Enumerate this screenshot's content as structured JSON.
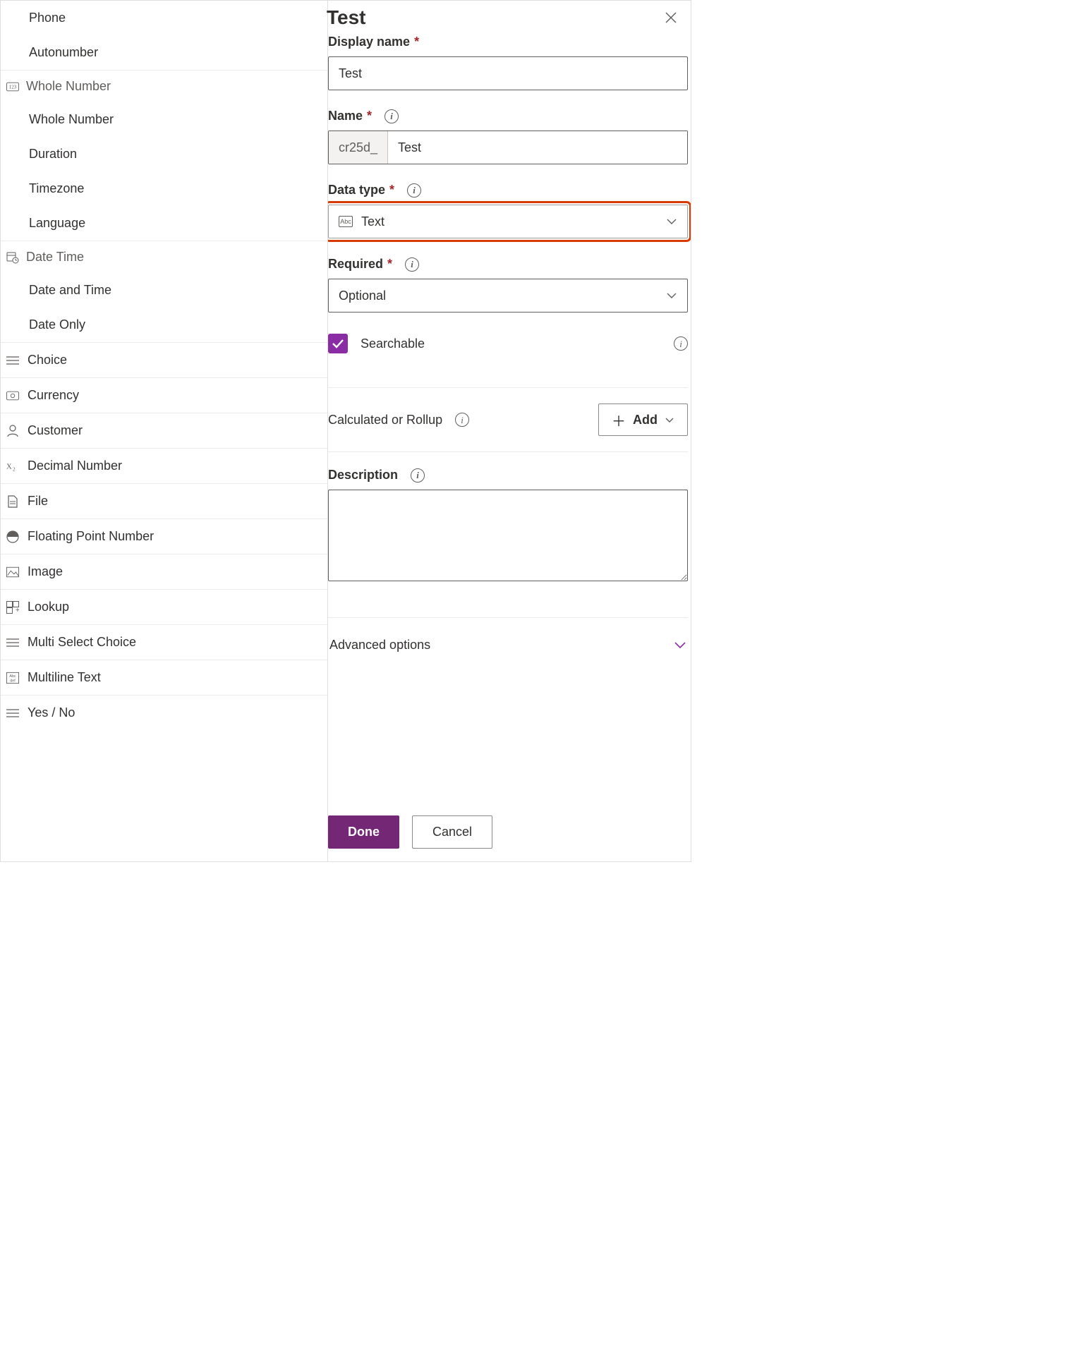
{
  "panel": {
    "title": "Test",
    "close_aria": "Close"
  },
  "fields": {
    "display_name": {
      "label": "Display name",
      "value": "Test"
    },
    "name": {
      "label": "Name",
      "prefix": "cr25d_",
      "value": "Test"
    },
    "data_type": {
      "label": "Data type",
      "value": "Text",
      "icon_text": "Abc"
    },
    "required": {
      "label": "Required",
      "value": "Optional"
    },
    "searchable": {
      "label": "Searchable",
      "checked": true
    },
    "calc_rollup": {
      "label": "Calculated or Rollup",
      "add_label": "Add"
    },
    "description": {
      "label": "Description",
      "value": ""
    },
    "advanced": {
      "label": "Advanced options"
    }
  },
  "footer": {
    "done": "Done",
    "cancel": "Cancel"
  },
  "datatype_picker": {
    "top_orphan_items": [
      "Phone",
      "Autonumber"
    ],
    "groups": [
      {
        "name": "Whole Number",
        "icon": "123",
        "items": [
          "Whole Number",
          "Duration",
          "Timezone",
          "Language"
        ]
      },
      {
        "name": "Date Time",
        "icon": "datetime",
        "items": [
          "Date and Time",
          "Date Only"
        ]
      }
    ],
    "flat_items": [
      {
        "label": "Choice",
        "icon": "list"
      },
      {
        "label": "Currency",
        "icon": "currency"
      },
      {
        "label": "Customer",
        "icon": "person"
      },
      {
        "label": "Decimal Number",
        "icon": "decimal"
      },
      {
        "label": "File",
        "icon": "file"
      },
      {
        "label": "Floating Point Number",
        "icon": "float"
      },
      {
        "label": "Image",
        "icon": "image"
      },
      {
        "label": "Lookup",
        "icon": "lookup"
      },
      {
        "label": "Multi Select Choice",
        "icon": "list"
      },
      {
        "label": "Multiline Text",
        "icon": "multiline"
      },
      {
        "label": "Yes / No",
        "icon": "list"
      }
    ]
  }
}
